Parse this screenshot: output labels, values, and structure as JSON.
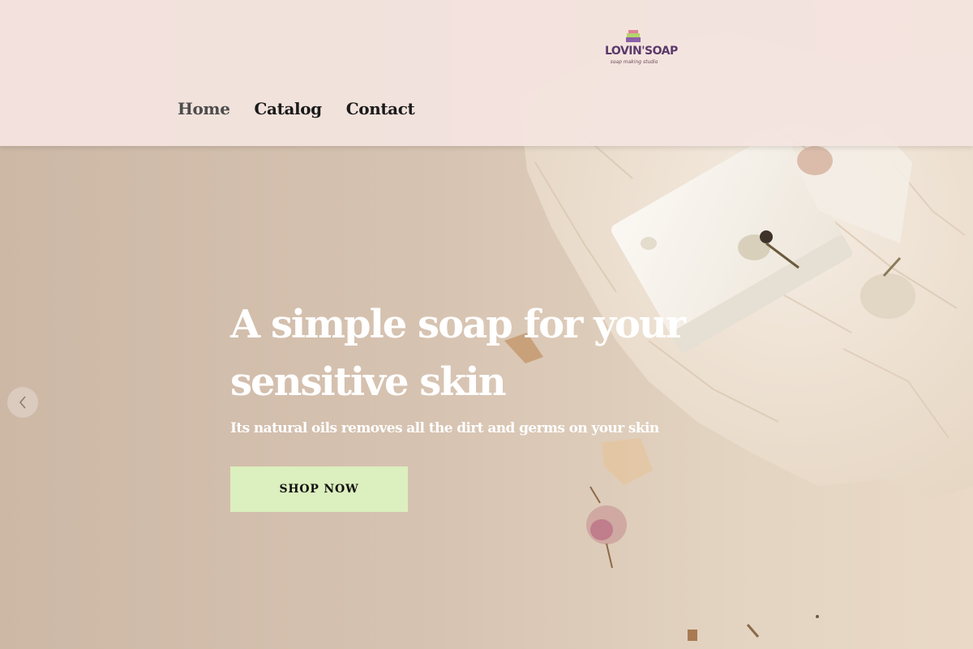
{
  "logo": {
    "brand": "LOVIN'SOAP",
    "tagline": "soap making studio"
  },
  "nav": {
    "items": [
      {
        "label": "Home",
        "active": true
      },
      {
        "label": "Catalog",
        "active": false
      },
      {
        "label": "Contact",
        "active": false
      }
    ]
  },
  "hero": {
    "headline": "A simple soap for your sensitive skin",
    "subtitle": "Its natural oils removes all the dirt and germs on your skin",
    "cta_label": "SHOP NOW",
    "prev_icon": "chevron-left-icon"
  },
  "colors": {
    "header_bg": "#f4e4e0",
    "cta_bg": "#dcefbe",
    "hero_bg": "#d5c1af",
    "brand_purple": "#5b3a6b"
  }
}
